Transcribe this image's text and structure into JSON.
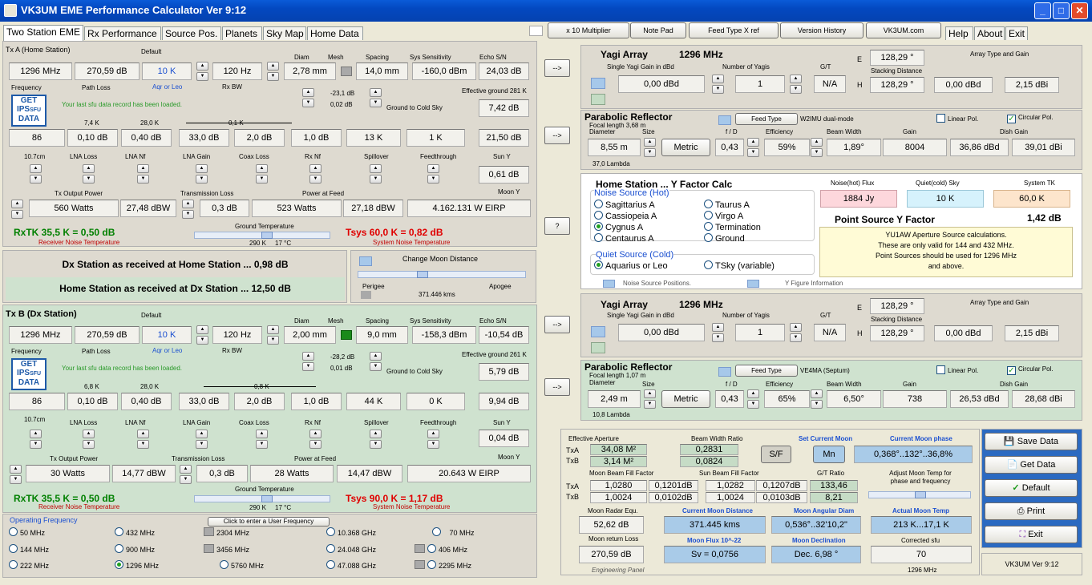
{
  "app": {
    "title": "VK3UM EME Performance Calculator Ver 9:12",
    "win_min": "_",
    "win_max": "□",
    "win_close": "✕"
  },
  "tabs": [
    "Two Station EME",
    "Rx Performance",
    "Source Pos.",
    "Planets",
    "Sky Map",
    "Home Data"
  ],
  "top_buttons": [
    "x 10 Multiplier",
    "Note Pad",
    "Feed Type X ref",
    "Version History",
    "VK3UM.com"
  ],
  "top_tabs": [
    "Help",
    "About",
    "Exit"
  ],
  "txA": {
    "title": "Tx A (Home Station)",
    "default": "Default",
    "diam": "Diam",
    "mesh": "Mesh",
    "spacing": "Spacing",
    "sys_sens": "Sys Sensitivity",
    "echo_sn": "Echo S/N",
    "freq": "1296 MHz",
    "path": "270,59 dB",
    "temp": "10 K",
    "rxbw": "120 Hz",
    "diam_v": "2,78 mm",
    "spacing_v": "14,0 mm",
    "sens_v": "-160,0 dBm",
    "echo_v": "24,03 dB",
    "freq_l": "Frequency",
    "path_l": "Path Loss",
    "aq_l": "Aqr or Leo",
    "rxbw_l": "Rx BW",
    "eff_gr_l": "Effective ground 281 K",
    "sfu_msg": "Your last sfu data record has been loaded.",
    "db1": "-23,1 dB",
    "db2": "0,02 dB",
    "gcs": "Ground to Cold Sky",
    "eff_gr_v": "7,42 dB",
    "k1": "7,4 K",
    "k2": "28,0 K",
    "k3": "0,1 K",
    "r3": [
      "86",
      "0,10 dB",
      "0,40 dB",
      "33,0 dB",
      "2,0 dB",
      "1,0 dB",
      "13 K",
      "1 K",
      "21,50 dB"
    ],
    "l4": [
      "10.7cm",
      "LNA Loss",
      "LNA Nf",
      "LNA Gain",
      "Coax Loss",
      "Rx Nf",
      "Spillover",
      "Feedthrough",
      "Sun Y"
    ],
    "sun_y": "0,61 dB",
    "txop": "Tx Output Power",
    "tll": "Transmission Loss",
    "paf": "Power at Feed",
    "moony": "Moon Y",
    "r5": [
      "560 Watts",
      "27,48 dBW",
      "0,3 dB",
      "523 Watts",
      "27,18 dBW",
      "4.162.131 W EIRP"
    ],
    "gt": "Ground Temperature",
    "gt1": "290 K",
    "gt2": "17 °C",
    "rxtk": "RxTK 35,5 K = 0,50 dB",
    "rnt": "Receiver Noise Temperature",
    "tsys": "Tsys 60,0 K = 0,82 dB",
    "snt": "System Noise Temperature"
  },
  "mid": {
    "dx_home": "Dx Station as received at Home Station ... 0,98 dB",
    "home_dx": "Home Station as received at Dx Station ... 12,50 dB",
    "cmd": "Change Moon Distance",
    "perigee": "Perigee",
    "apogee": "Apogee",
    "dist": "371.446 kms"
  },
  "txB": {
    "title": "Tx B (Dx Station)",
    "default": "Default",
    "diam": "Diam",
    "mesh": "Mesh",
    "spacing": "Spacing",
    "sys_sens": "Sys Sensitivity",
    "echo_sn": "Echo S/N",
    "freq": "1296 MHz",
    "path": "270,59 dB",
    "temp": "10 K",
    "rxbw": "120 Hz",
    "diam_v": "2,00 mm",
    "spacing_v": "9,0 mm",
    "sens_v": "-158,3 dBm",
    "echo_v": "-10,54 dB",
    "freq_l": "Frequency",
    "path_l": "Path Loss",
    "aq_l": "Aqr or Leo",
    "rxbw_l": "Rx BW",
    "eff_gr_l": "Effective ground 261 K",
    "sfu_msg": "Your last sfu data record has been loaded.",
    "db1": "-28,2 dB",
    "db2": "0,01 dB",
    "gcs": "Ground to Cold Sky",
    "eff_gr_v": "5,79 dB",
    "k1": "6,8 K",
    "k2": "28,0 K",
    "k3": "0,8 K",
    "r3": [
      "86",
      "0,10 dB",
      "0,40 dB",
      "33,0 dB",
      "2,0 dB",
      "1,0 dB",
      "44 K",
      "0 K",
      "9,94 dB"
    ],
    "l4": [
      "10.7cm",
      "LNA Loss",
      "LNA Nf",
      "LNA Gain",
      "Coax Loss",
      "Rx Nf",
      "Spillover",
      "Feedthrough",
      "Sun Y"
    ],
    "sun_y": "0,04 dB",
    "txop": "Tx Output Power",
    "tll": "Transmission Loss",
    "paf": "Power at Feed",
    "moony": "Moon Y",
    "r5": [
      "30 Watts",
      "14,77 dBW",
      "0,3 dB",
      "28 Watts",
      "14,47 dBW",
      "20.643 W EIRP"
    ],
    "gt": "Ground Temperature",
    "gt1": "290 K",
    "gt2": "17 °C",
    "rxtk": "RxTK 35,5 K = 0,50 dB",
    "rnt": "Receiver Noise Temperature",
    "tsys": "Tsys 90,0 K = 1,17 dB",
    "snt": "System Noise Temperature"
  },
  "opfreq": {
    "title": "Operating Frequency",
    "user": "Click to enter a User Frequency",
    "items": [
      "50 MHz",
      "432 MHz",
      "2304 MHz",
      "10.368 GHz",
      "70 MHz",
      "144 MHz",
      "900 MHz",
      "3456 MHz",
      "24.048 GHz",
      "406 MHz",
      "222 MHz",
      "1296 MHz",
      "5760 MHz",
      "47.088 GHz",
      "2295 MHz"
    ]
  },
  "yagiA": {
    "title": "Yagi Array",
    "freq": "1296 MHz",
    "sg": "Single Yagi Gain in dBd",
    "ny": "Number of Yagis",
    "gt": "G/T",
    "e": "E",
    "h": "H",
    "sd": "Stacking Distance",
    "atg": "Array Type and Gain",
    "gain": "0,00 dBd",
    "n": "1",
    "na": "N/A",
    "e_v": "128,29 °",
    "h_v": "128,29 °",
    "g1": "0,00 dBd",
    "g2": "2,15 dBi"
  },
  "parA": {
    "title": "Parabolic Reflector",
    "fl": "Focal length 3,68 m",
    "ft": "Feed Type",
    "feed": "W2IMU dual-mode",
    "lin": "Linear Pol.",
    "circ": "Circular Pol.",
    "dia": "Diameter",
    "size": "Size",
    "fd": "f / D",
    "eff": "Efficiency",
    "bw": "Beam Width",
    "gain": "Gain",
    "dg": "Dish Gain",
    "dia_v": "8,55 m",
    "metric": "Metric",
    "fd_v": "0,43",
    "eff_v": "59%",
    "bw_v": "1,89°",
    "gain_v": "8004",
    "g1": "36,86 dBd",
    "g2": "39,01 dBi",
    "lam": "37,0 Lambda"
  },
  "yf": {
    "title": "Home Station ... Y Factor Calc",
    "ns": "Noise Source (Hot)",
    "nf": "Noise(hot) Flux",
    "qs": "Quiet(cold) Sky",
    "stk": "System TK",
    "nf_v": "1884 Jy",
    "qs_v": "10 K",
    "stk_v": "60,0 K",
    "r1": [
      "Sagittarius A",
      "Cassiopeia A",
      "Cygnus A",
      "Centaurus A"
    ],
    "r2": [
      "Taurus A",
      "Virgo A",
      "Termination",
      "Ground"
    ],
    "psy": "Point Source Y Factor",
    "psy_v": "1,42 dB",
    "note1": "YU1AW  Aperture Source calculations.",
    "note2": "These are only valid for 144 and 432 MHz.",
    "note3": "Point Sources should be used for 1296 MHz",
    "note4": "and above.",
    "qsc": "Quiet Source  (Cold)",
    "aq": "Aquarius or Leo",
    "tsky": "TSky (variable)",
    "nsp": "Noise Source Positions.",
    "yfi": "Y Figure Information"
  },
  "yagiB": {
    "title": "Yagi Array",
    "freq": "1296 MHz",
    "sg": "Single Yagi Gain in dBd",
    "ny": "Number of Yagis",
    "gt": "G/T",
    "e": "E",
    "h": "H",
    "sd": "Stacking Distance",
    "atg": "Array Type and Gain",
    "gain": "0,00 dBd",
    "n": "1",
    "na": "N/A",
    "e_v": "128,29 °",
    "h_v": "128,29 °",
    "g1": "0,00 dBd",
    "g2": "2,15 dBi"
  },
  "parB": {
    "title": "Parabolic Reflector",
    "fl": "Focal length 1,07 m",
    "ft": "Feed Type",
    "feed": "VE4MA (Septum)",
    "lin": "Linear Pol.",
    "circ": "Circular Pol.",
    "dia": "Diameter",
    "size": "Size",
    "fd": "f / D",
    "eff": "Efficiency",
    "bw": "Beam Width",
    "gain": "Gain",
    "dg": "Dish Gain",
    "dia_v": "2,49 m",
    "metric": "Metric",
    "fd_v": "0,43",
    "eff_v": "65%",
    "bw_v": "6,50°",
    "gain_v": "738",
    "g1": "26,53 dBd",
    "g2": "28,68 dBi",
    "lam": "10,8 Lambda"
  },
  "eng": {
    "ea": "Effective Aperture",
    "txa": "TxA",
    "txb": "TxB",
    "ea_a": "34,08 M²",
    "ea_b": "3,14 M²",
    "bwr": "Beam Width Ratio",
    "bwr_a": "0,2831",
    "bwr_b": "0,0824",
    "sf": "S/F",
    "scm": "Set Current Moon",
    "mn": "Mn",
    "cmp": "Current Moon phase",
    "cmp_v": "0,368°..132°..36,8%",
    "mbf": "Moon Beam Fill Factor",
    "sbf": "Sun Beam Fill Factor",
    "gtr": "G/T Ratio",
    "amt": "Adjust Moon Temp for phase and frequency",
    "mbf_a1": "1,0280",
    "mbf_a2": "0,1201dB",
    "mbf_b1": "1,0024",
    "mbf_b2": "0,0102dB",
    "sbf_a1": "1,0282",
    "sbf_a2": "0,1207dB",
    "sbf_b1": "1,0024",
    "sbf_b2": "0,0103dB",
    "gtr_a": "133,46",
    "gtr_b": "8,21",
    "mre": "Moon Radar Equ.",
    "cmd": "Current Moon Distance",
    "mad": "Moon Angular Diam",
    "amt2": "Actual Moon Temp",
    "mre_v": "52,62 dB",
    "cmd_v": "371.445 kms",
    "mad_v": "0,536°..32'10,2\"",
    "amt_v": "213 K...17,1 K",
    "mrl": "Moon return Loss",
    "mf": "Moon Flux 10^-22",
    "md": "Moon Declination",
    "csfu": "Corrected sfu",
    "mrl_v": "270,59 dB",
    "mf_v": "Sv = 0,0756",
    "md_v": "Dec. 6,98 °",
    "csfu_v": "70",
    "ep": "Engineering Panel",
    "mhz": "1296 MHz"
  },
  "side": {
    "save": "Save Data",
    "get": "Get Data",
    "def": "Default",
    "print": "Print",
    "exit": "Exit",
    "ver": "VK3UM Ver 9:12"
  },
  "arrows": [
    "-->",
    "-->",
    "?",
    "-->",
    "-->"
  ],
  "gips": "GET IPS sfu DATA",
  "colors": {
    "title_bar": "#0348c0",
    "panel_grey": "#dedad0",
    "panel_green": "#cfe2cf",
    "tsys_red": "#e00000",
    "rxtk_green": "#008000"
  }
}
